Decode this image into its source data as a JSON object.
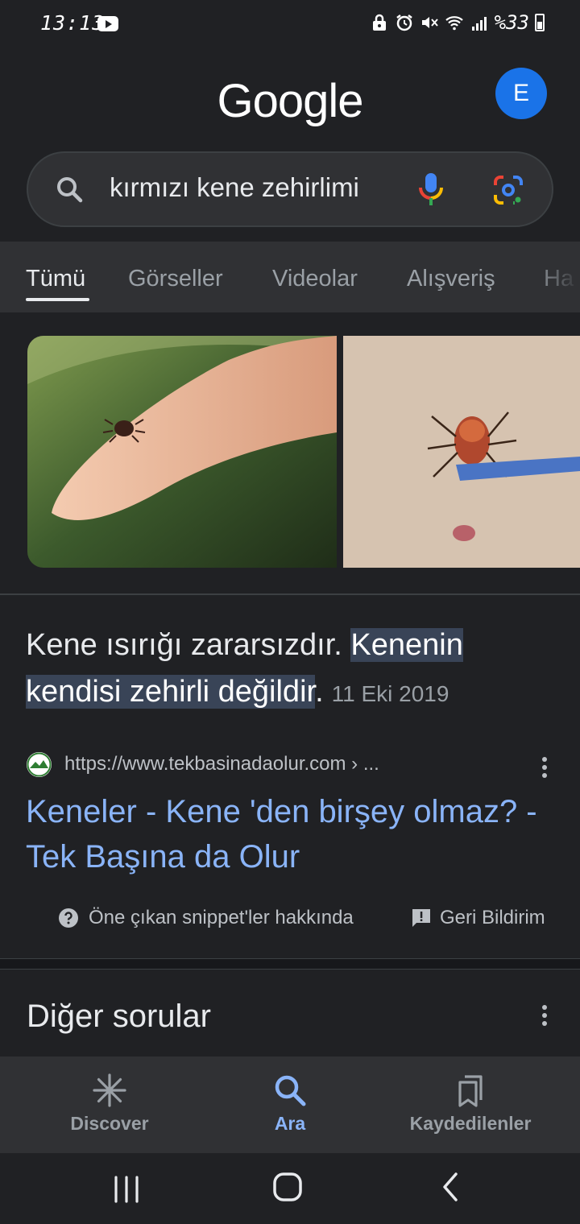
{
  "status_bar": {
    "time": "13:13",
    "battery": "%33"
  },
  "header": {
    "logo": "Google",
    "avatar_letter": "E"
  },
  "search": {
    "query": "kırmızı kene zehirlimi"
  },
  "tabs": [
    {
      "label": "Tümü",
      "active": true
    },
    {
      "label": "Görseller",
      "active": false
    },
    {
      "label": "Videolar",
      "active": false
    },
    {
      "label": "Alışveriş",
      "active": false
    },
    {
      "label": "Ha",
      "active": false
    }
  ],
  "featured_snippet": {
    "text_plain": "Kene ısırığı zararsızdır. ",
    "text_highlight_1": "Kenenin",
    "text_highlight_2": "kendisi zehirli değildir",
    "text_end": ".",
    "date": "11 Eki 2019",
    "source_url": "https://www.tekbasinadaolur.com › ...",
    "result_title": "Keneler - Kene 'den birşey olmaz? - Tek Başına da Olur",
    "about_label": "Öne çıkan snippet'ler hakkında",
    "feedback_label": "Geri Bildirim"
  },
  "other_questions": {
    "title": "Diğer sorular"
  },
  "bottom_nav": {
    "items": [
      {
        "label": "Discover",
        "icon": "asterisk-icon",
        "active": false
      },
      {
        "label": "Ara",
        "icon": "search-icon",
        "active": true
      },
      {
        "label": "Kaydedilenler",
        "icon": "bookmarks-icon",
        "active": false
      }
    ]
  },
  "colors": {
    "background": "#202124",
    "link": "#8ab4f8",
    "highlight": "#394457",
    "avatar": "#1a73e8"
  }
}
